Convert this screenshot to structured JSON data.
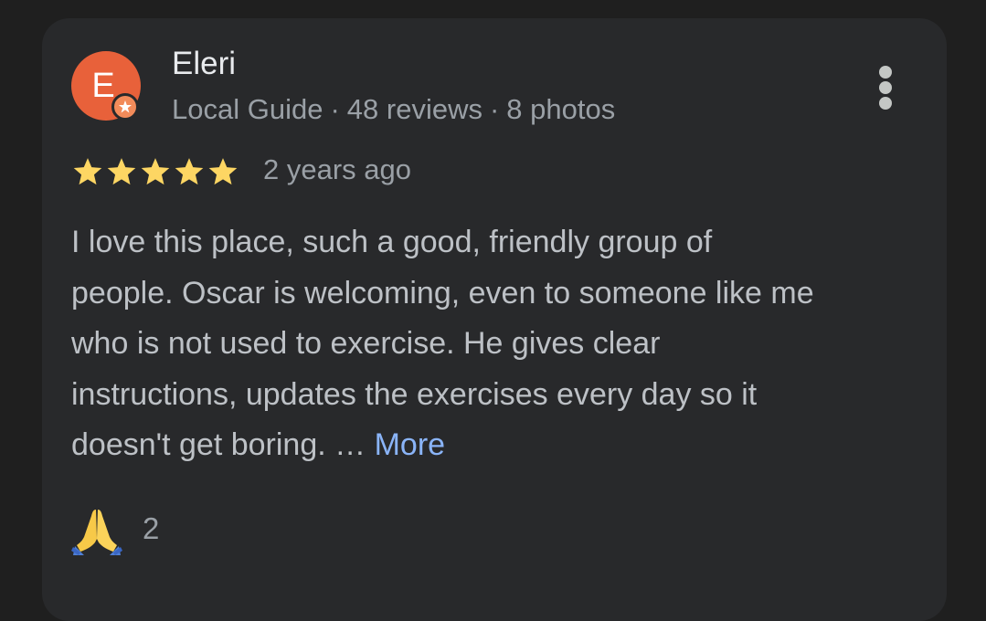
{
  "reviewer": {
    "initial": "E",
    "name": "Eleri",
    "role": "Local Guide",
    "reviews": "48 reviews",
    "photos": "8 photos",
    "separator": "·",
    "avatar_color": "#e8613a"
  },
  "review": {
    "rating": 5,
    "time_ago": "2 years ago",
    "lines": [
      "I love this place, such a good, friendly group of",
      "people. Oscar is welcoming, even to someone like me",
      "who is not used to exercise. He gives clear",
      "instructions, updates the exercises every day so it",
      "doesn't get boring. …"
    ],
    "more_label": "More"
  },
  "reaction": {
    "icon": "folded-hands-icon",
    "count": "2"
  },
  "colors": {
    "star": "#fdd663",
    "link": "#8ab4f8",
    "card": "#28292b"
  }
}
